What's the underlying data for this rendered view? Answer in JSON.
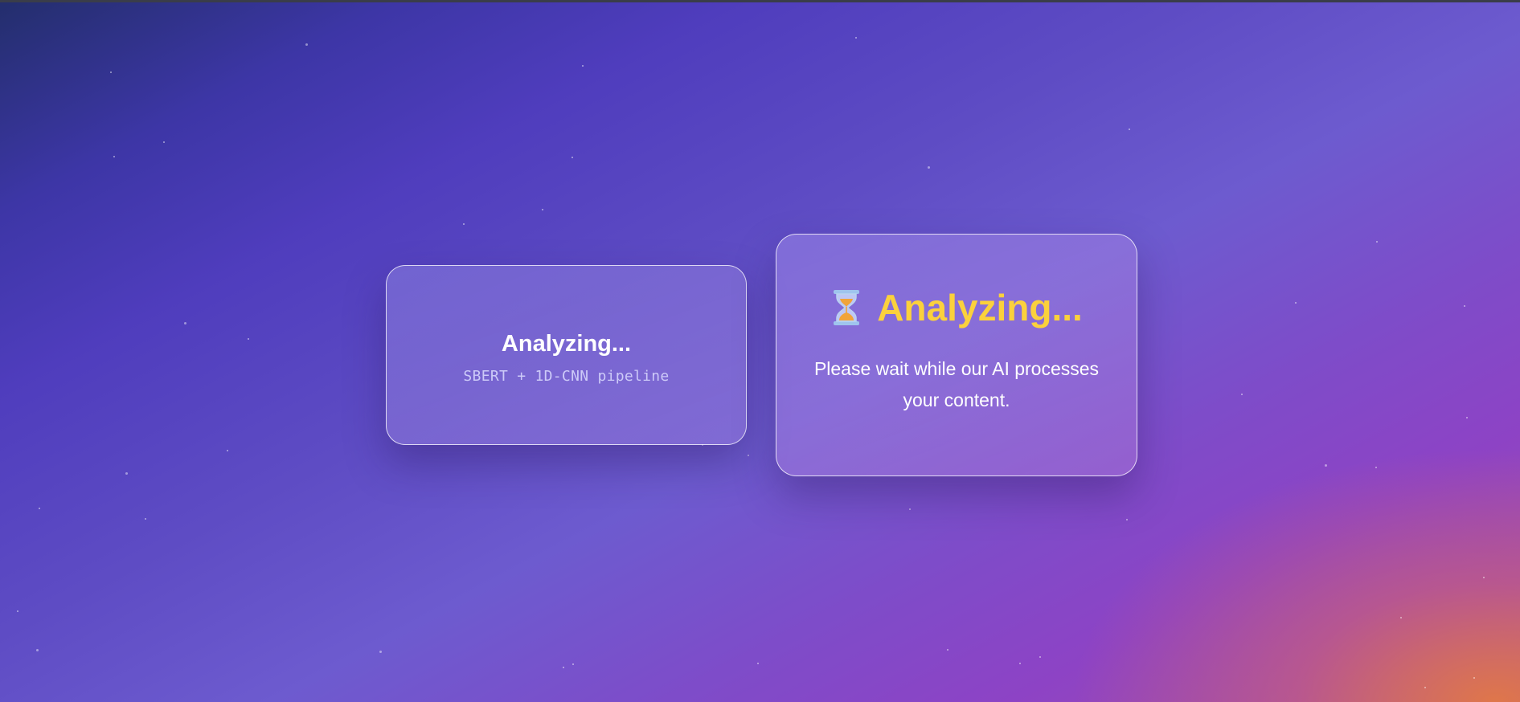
{
  "loading_card": {
    "title": "Analyzing...",
    "subtitle": "SBERT + 1D-CNN pipeline"
  },
  "status_card": {
    "icon": "hourglass-icon",
    "title": "Analyzing...",
    "message": "Please wait while our AI processes your content.",
    "title_color": "#fbd13c"
  },
  "colors": {
    "background_start": "#232e6c",
    "background_mid": "#5e4cc4",
    "background_end": "#e27846"
  }
}
